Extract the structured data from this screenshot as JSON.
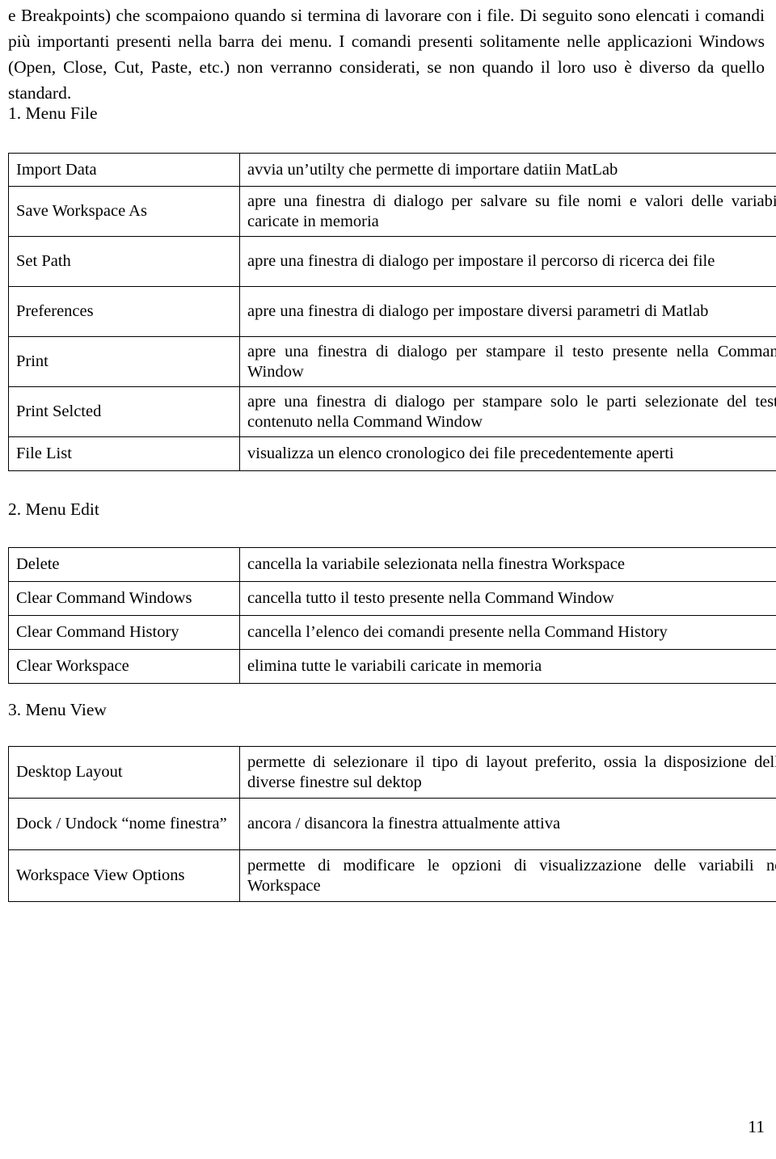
{
  "document": {
    "intro_paragraph": "e Breakpoints) che scompaiono quando si termina di lavorare con i file. Di seguito sono elencati i comandi più importanti presenti nella barra dei menu. I comandi presenti solitamente nelle applicazioni Windows (Open, Close, Cut, Paste, etc.) non verranno considerati, se non quando il loro uso è diverso da quello standard.",
    "page_number": "11"
  },
  "sections": [
    {
      "heading": "1. Menu File",
      "rows": [
        {
          "command": "Import Data",
          "description": "avvia un’utilty che permette di importare datiin MatLab"
        },
        {
          "command": "Save Workspace As",
          "description": "apre una finestra di dialogo per salvare su file nomi e valori delle variabili caricate in memoria"
        },
        {
          "command": "Set Path",
          "description": "apre una finestra di dialogo per impostare il percorso di ricerca dei file"
        },
        {
          "command": "Preferences",
          "description": "apre una finestra di dialogo per impostare diversi parametri di Matlab"
        },
        {
          "command": "Print",
          "description": "apre una finestra di dialogo per stampare il testo presente nella Command Window"
        },
        {
          "command": "Print Selcted",
          "description": "apre una finestra di dialogo per stampare solo le parti selezionate del testo contenuto nella Command Window"
        },
        {
          "command": "File List",
          "description": "visualizza un elenco cronologico dei file precedentemente aperti"
        }
      ]
    },
    {
      "heading": "2. Menu Edit",
      "rows": [
        {
          "command": "Delete",
          "description": "cancella la variabile selezionata nella finestra Workspace"
        },
        {
          "command": "Clear Command Windows",
          "description": "cancella tutto il testo presente nella Command Window"
        },
        {
          "command": "Clear Command History",
          "description": "cancella l’elenco dei comandi presente nella Command History"
        },
        {
          "command": "Clear Workspace",
          "description": "elimina tutte le variabili caricate in memoria"
        }
      ]
    },
    {
      "heading": "3. Menu View",
      "rows": [
        {
          "command": "Desktop Layout",
          "description": "permette di selezionare il tipo di layout preferito, ossia la disposizione delle diverse finestre sul dektop"
        },
        {
          "command": "Dock / Undock “nome finestra”",
          "description": "ancora / disancora la finestra attualmente attiva"
        },
        {
          "command": "Workspace View Options",
          "description": "permette di modificare le opzioni di visualizzazione delle variabili nel Workspace"
        }
      ]
    }
  ]
}
